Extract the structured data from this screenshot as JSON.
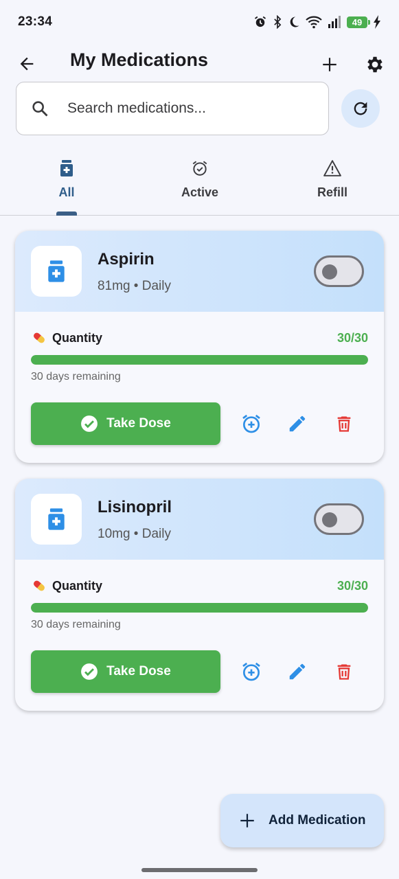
{
  "status_bar": {
    "time": "23:34",
    "battery": "49",
    "icons": [
      "alarm-icon",
      "bluetooth-icon",
      "dnd-moon-icon",
      "wifi-icon",
      "signal-icon",
      "battery-icon",
      "charging-icon"
    ]
  },
  "app_bar": {
    "title": "My Medications",
    "back_icon": "arrow-back-icon",
    "add_icon": "plus-icon",
    "settings_icon": "gear-icon"
  },
  "search": {
    "placeholder": "Search medications...",
    "value": ""
  },
  "tabs": [
    {
      "label": "All",
      "icon": "medication-icon",
      "active": true
    },
    {
      "label": "Active",
      "icon": "alarm-check-icon",
      "active": false
    },
    {
      "label": "Refill",
      "icon": "warning-icon",
      "active": false
    }
  ],
  "medications": [
    {
      "name": "Aspirin",
      "dose": "81mg • Daily",
      "enabled": false,
      "quantity_label": "Quantity",
      "quantity_value": "30/30",
      "quantity_fraction": 1.0,
      "days_remaining": "30 days remaining",
      "take_label": "Take Dose"
    },
    {
      "name": "Lisinopril",
      "dose": "10mg • Daily",
      "enabled": false,
      "quantity_label": "Quantity",
      "quantity_value": "30/30",
      "quantity_fraction": 1.0,
      "days_remaining": "30 days remaining",
      "take_label": "Take Dose"
    }
  ],
  "fab": {
    "label": "Add Medication",
    "icon": "plus-icon"
  },
  "colors": {
    "accent_blue": "#2e8fe6",
    "success_green": "#4caf50",
    "danger_red": "#e53935",
    "tab_active": "#2f5d8a",
    "card_header": "#c4e0fb"
  }
}
